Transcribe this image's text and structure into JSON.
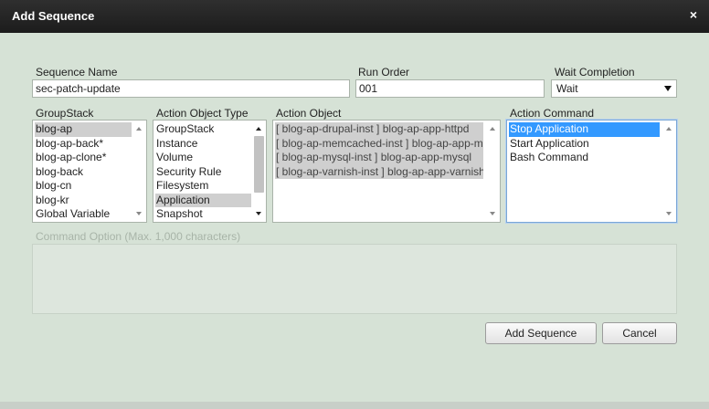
{
  "dialog": {
    "title": "Add Sequence"
  },
  "form": {
    "sequence_name_label": "Sequence Name",
    "sequence_name_value": "sec-patch-update",
    "run_order_label": "Run Order",
    "run_order_value": "001",
    "wait_completion_label": "Wait Completion",
    "wait_completion_value": "Wait",
    "groupstack_label": "GroupStack",
    "groupstack_items": [
      "blog-ap",
      "blog-ap-back*",
      "blog-ap-clone*",
      "blog-back",
      "blog-cn",
      "blog-kr",
      "Global Variable"
    ],
    "action_object_type_label": "Action Object Type",
    "action_object_type_items": [
      "GroupStack",
      "Instance",
      "Volume",
      "Security Rule",
      "Filesystem",
      "Application",
      "Snapshot"
    ],
    "action_object_label": "Action Object",
    "action_object_items": [
      "[ blog-ap-drupal-inst ] blog-ap-app-httpd",
      "[ blog-ap-memcached-inst ] blog-ap-app-memcached",
      "[ blog-ap-mysql-inst ] blog-ap-app-mysql",
      "[ blog-ap-varnish-inst ] blog-ap-app-varnish"
    ],
    "action_command_label": "Action Command",
    "action_command_items": [
      "Stop Application",
      "Start Application",
      "Bash Command"
    ],
    "command_option_label": "Command Option (Max. 1,000 characters)",
    "command_option_value": ""
  },
  "buttons": {
    "add_label": "Add Sequence",
    "cancel_label": "Cancel"
  },
  "icons": {
    "close": "close-icon"
  }
}
